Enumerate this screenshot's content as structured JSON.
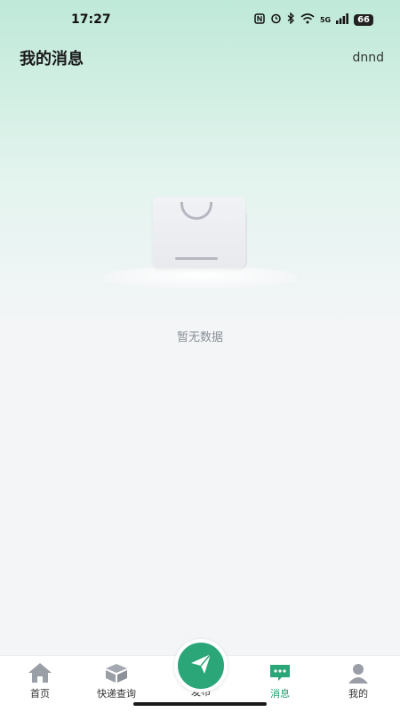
{
  "status_bar": {
    "time": "17:27",
    "network": "5G",
    "battery": "66"
  },
  "header": {
    "title": "我的消息",
    "user": "dnnd"
  },
  "empty_state": {
    "text": "暂无数据"
  },
  "tabbar": {
    "items": [
      {
        "label": "首页",
        "icon": "home-icon"
      },
      {
        "label": "快递查询",
        "icon": "package-icon"
      },
      {
        "label": "发布",
        "icon": "send-icon"
      },
      {
        "label": "消息",
        "icon": "message-icon",
        "active": true
      },
      {
        "label": "我的",
        "icon": "profile-icon"
      }
    ]
  },
  "colors": {
    "accent": "#2ba678",
    "active_tab": "#1f9e70"
  }
}
